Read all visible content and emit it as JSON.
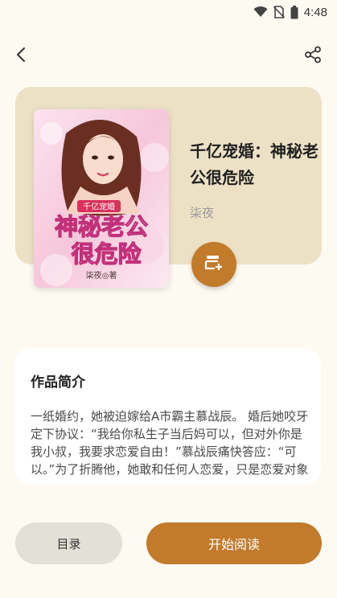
{
  "status_bar": {
    "time": "4:48"
  },
  "book": {
    "title": "千亿宠婚：神秘老公很危险",
    "author": "柒夜",
    "cover": {
      "series_tag": "千亿宠婚",
      "line1": "神秘老公",
      "line2": "很危险",
      "author_credit": "柒夜◎著"
    }
  },
  "intro": {
    "heading": "作品简介",
    "text": "一纸婚约，她被迫嫁给A市霸主慕战辰。 婚后她咬牙定下协议：“我给你私生子当后妈可以，但对外你是我小叔，我要求恋爱自由！”慕战辰痛快答应：“可以。”为了折腾他，她敢和任何人恋爱，只是恋爱对象好像不那么勇敢。 追求者"
  },
  "actions": {
    "catalog_label": "目录",
    "read_label": "开始阅读"
  },
  "colors": {
    "accent": "#c27a2b",
    "card_bg": "#ede1c5",
    "page_bg": "#fdfaf2"
  },
  "icons": {
    "back": "back-arrow-icon",
    "share": "share-icon",
    "add_to_shelf": "add-bookshelf-icon"
  }
}
